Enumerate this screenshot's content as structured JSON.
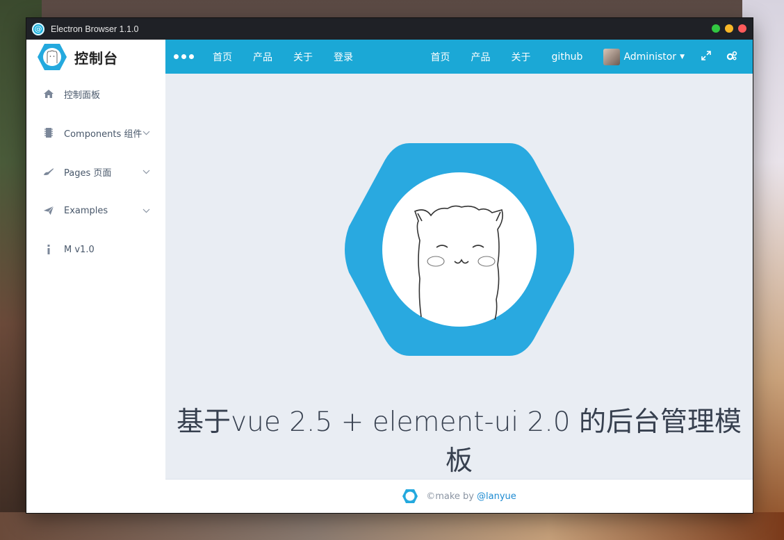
{
  "window": {
    "title": "Electron Browser 1.1.0",
    "controls": [
      "green",
      "yellow",
      "red"
    ],
    "control_colors": [
      "#32c741",
      "#f7b728",
      "#ff5b5b"
    ]
  },
  "sidebar": {
    "brand": "控制台",
    "items": [
      {
        "label": "控制面板",
        "icon": "home-icon",
        "has_caret": false
      },
      {
        "label": "Components 组件",
        "icon": "chip-icon",
        "has_caret": true
      },
      {
        "label": "Pages 页面",
        "icon": "brush-icon",
        "has_caret": true
      },
      {
        "label": "Examples",
        "icon": "paper-plane-icon",
        "has_caret": true
      },
      {
        "label": "M v1.0",
        "icon": "info-icon",
        "has_caret": false
      }
    ]
  },
  "topnav": {
    "left_links": [
      "首页",
      "产品",
      "关于",
      "登录"
    ],
    "right_links": [
      "首页",
      "产品",
      "关于",
      "github"
    ],
    "user": "Administor",
    "accent": "#1ba8d6"
  },
  "main": {
    "headline": "基于vue 2.5 + element-ui 2.0 的后台管理模板"
  },
  "footer": {
    "prefix": "©make by",
    "author": "@lanyue"
  }
}
